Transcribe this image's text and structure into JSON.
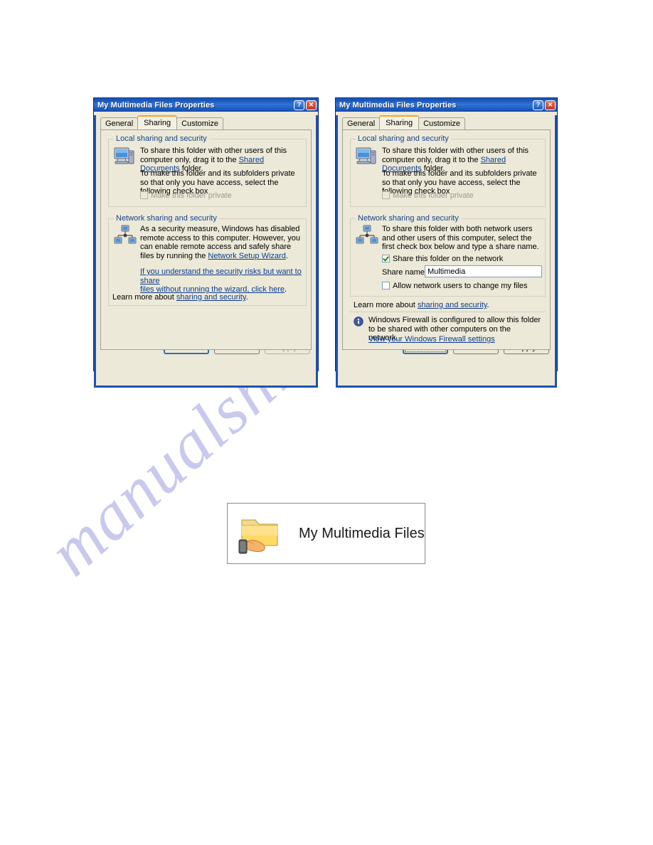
{
  "page": {
    "watermark_text": "manualshiv"
  },
  "dialogs": [
    {
      "id": "left",
      "title": "My Multimedia Files Properties",
      "titlebar": {
        "help_label": "?",
        "close_label": "✕"
      },
      "tabs": [
        {
          "label": "General",
          "active": false
        },
        {
          "label": "Sharing",
          "active": true
        },
        {
          "label": "Customize",
          "active": false
        }
      ],
      "local_group": {
        "title": "Local sharing and security",
        "icon": "computer-icon",
        "para1_before": "To share this folder with other users of this computer only, drag it to the ",
        "para1_link": "Shared Documents",
        "para1_after": " folder.",
        "para2": "To make this folder and its subfolders private so that only you have access, select the following check box",
        "checkbox_label": "Make this folder private",
        "checkbox_checked": false,
        "checkbox_disabled": true
      },
      "network_group": {
        "title": "Network sharing and security",
        "icon": "network-computers-icon",
        "para1": "As a security measure, Windows has disabled remote access to this computer. However, you can enable remote access and safely share files by running the ",
        "wizard_link": "Network Setup Wizard",
        "para1_end": ".",
        "risk_link_line1": "If you understand the security risks but want to share",
        "risk_link_line2": "files without running the wizard, click here",
        "risk_link_end": ".",
        "learn_more_prefix": "Learn more about ",
        "learn_more_link": "sharing and security",
        "learn_more_suffix": "."
      },
      "buttons": [
        {
          "label": "OK",
          "state": "default"
        },
        {
          "label": "Cancel",
          "state": "normal"
        },
        {
          "label": "Apply",
          "state": "disabled"
        }
      ]
    },
    {
      "id": "right",
      "title": "My Multimedia Files Properties",
      "titlebar": {
        "help_label": "?",
        "close_label": "✕"
      },
      "tabs": [
        {
          "label": "General",
          "active": false
        },
        {
          "label": "Sharing",
          "active": true
        },
        {
          "label": "Customize",
          "active": false
        }
      ],
      "local_group": {
        "title": "Local sharing and security",
        "icon": "computer-icon",
        "para1_before": "To share this folder with other users of this computer only, drag it to the ",
        "para1_link": "Shared Documents",
        "para1_after": " folder.",
        "para2": "To make this folder and its subfolders private so that only you have access, select the following check box",
        "checkbox_label": "Make this folder private",
        "checkbox_checked": false,
        "checkbox_disabled": true
      },
      "network_group": {
        "title": "Network sharing and security",
        "icon": "network-computers-icon",
        "para1": "To share this folder with both network users and other users of this computer, select the first check box below and type a share name.",
        "share_checkbox_label": "Share this folder on the network",
        "share_checkbox_checked": true,
        "share_name_label": "Share name:",
        "share_name_value": "Multimedia",
        "allow_checkbox_label": "Allow network users to change my files",
        "allow_checkbox_checked": false,
        "learn_more_prefix": "Learn more about ",
        "learn_more_link": "sharing and security",
        "learn_more_suffix": "."
      },
      "firewall": {
        "icon": "info-icon",
        "text": "Windows Firewall is configured to allow this folder to be shared with other computers on the network.",
        "link": "View your Windows Firewall settings"
      },
      "buttons": [
        {
          "label": "OK",
          "state": "default-focused"
        },
        {
          "label": "Cancel",
          "state": "normal"
        },
        {
          "label": "Apply",
          "state": "normal"
        }
      ]
    }
  ],
  "folder_figure": {
    "icon": "shared-folder-icon",
    "label": "My Multimedia Files"
  }
}
